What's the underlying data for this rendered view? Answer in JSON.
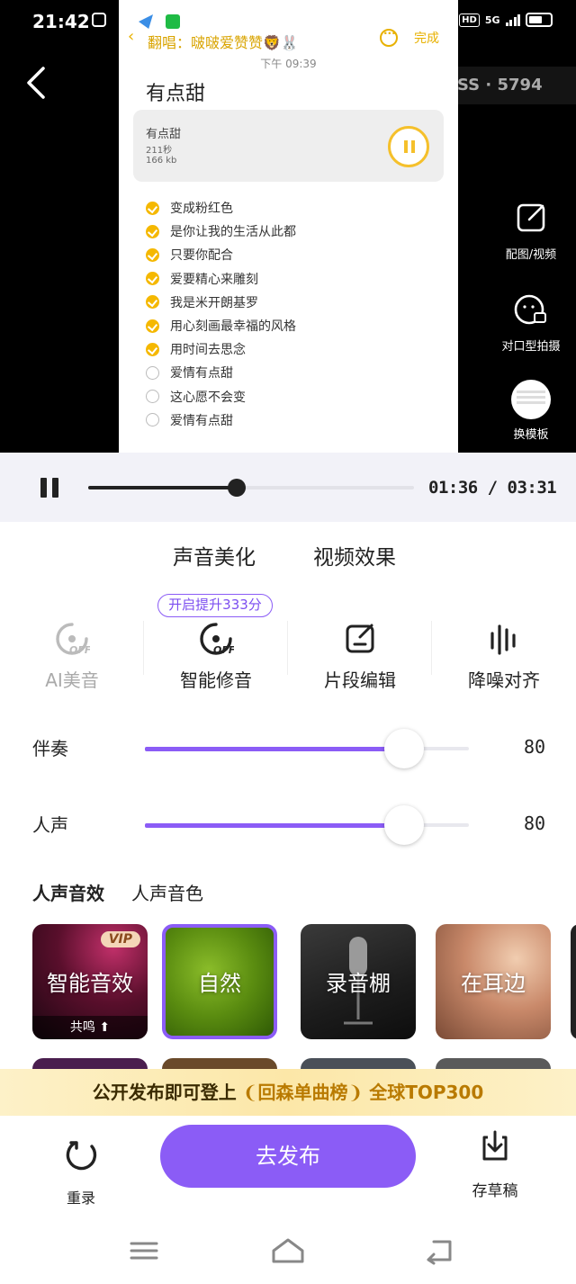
{
  "status_bar": {
    "time": "21:42",
    "network": "5G",
    "hd": "HD"
  },
  "preview": {
    "chat": {
      "title": "翻唱：啵啵爱赞赞🦁🐰",
      "more_icon": "more-icon",
      "done_label": "完成",
      "timestamp": "下午 09:39",
      "song_title": "有点甜",
      "audio": {
        "name": "有点甜",
        "duration": "211秒",
        "size": "166 kb"
      },
      "lyrics": [
        {
          "text": "变成粉红色",
          "checked": true
        },
        {
          "text": "是你让我的生活从此都",
          "checked": true
        },
        {
          "text": "只要你配合",
          "checked": true
        },
        {
          "text": "爱要精心来雕刻",
          "checked": true
        },
        {
          "text": "我是米开朗基罗",
          "checked": true
        },
        {
          "text": "用心刻画最幸福的风格",
          "checked": true
        },
        {
          "text": "用时间去思念",
          "checked": true
        },
        {
          "text": "爱情有点甜",
          "checked": false
        },
        {
          "text": "这心愿不会变",
          "checked": false
        },
        {
          "text": "爱情有点甜",
          "checked": false
        }
      ]
    },
    "counter": "SS · 5794",
    "side_tools": [
      {
        "label": "配图/视频",
        "icon": "edit-image-icon"
      },
      {
        "label": "对口型拍摄",
        "icon": "lip-sync-camera-icon"
      },
      {
        "label": "换模板",
        "icon": "template-thumbnail"
      }
    ]
  },
  "player": {
    "progress": 0.455,
    "current": "01:36",
    "separator": " / ",
    "total": "03:31"
  },
  "tabs": [
    {
      "label": "声音美化",
      "active": true
    },
    {
      "label": "视频效果",
      "active": false
    }
  ],
  "boost_label": "开启提升333分",
  "tools": [
    {
      "label": "AI美音",
      "icon": "ai-voice-off-icon",
      "enabled": false
    },
    {
      "label": "智能修音",
      "icon": "smart-tune-off-icon",
      "enabled": true
    },
    {
      "label": "片段编辑",
      "icon": "segment-edit-icon",
      "enabled": true
    },
    {
      "label": "降噪对齐",
      "icon": "denoise-align-icon",
      "enabled": true
    }
  ],
  "sliders": [
    {
      "label": "伴奏",
      "value": 80,
      "fraction": 0.8
    },
    {
      "label": "人声",
      "value": 80,
      "fraction": 0.8
    }
  ],
  "effect_tabs": [
    {
      "label": "人声音效",
      "active": true
    },
    {
      "label": "人声音色",
      "active": false
    }
  ],
  "effects": [
    {
      "label": "智能音效",
      "badge": "VIP",
      "sub": "共鸣 ⬆",
      "selected": false
    },
    {
      "label": "自然",
      "selected": true
    },
    {
      "label": "录音棚",
      "selected": false
    },
    {
      "label": "在耳边",
      "selected": false
    }
  ],
  "promo": {
    "prefix": "公开发布即可登上",
    "highlight": "回森单曲榜",
    "suffix": "全球TOP300"
  },
  "actions": {
    "rerecord": "重录",
    "publish": "去发布",
    "draft": "存草稿"
  },
  "colors": {
    "accent": "#8b5cf6",
    "yellow": "#f5b800",
    "highlight": "#f5dc37"
  }
}
